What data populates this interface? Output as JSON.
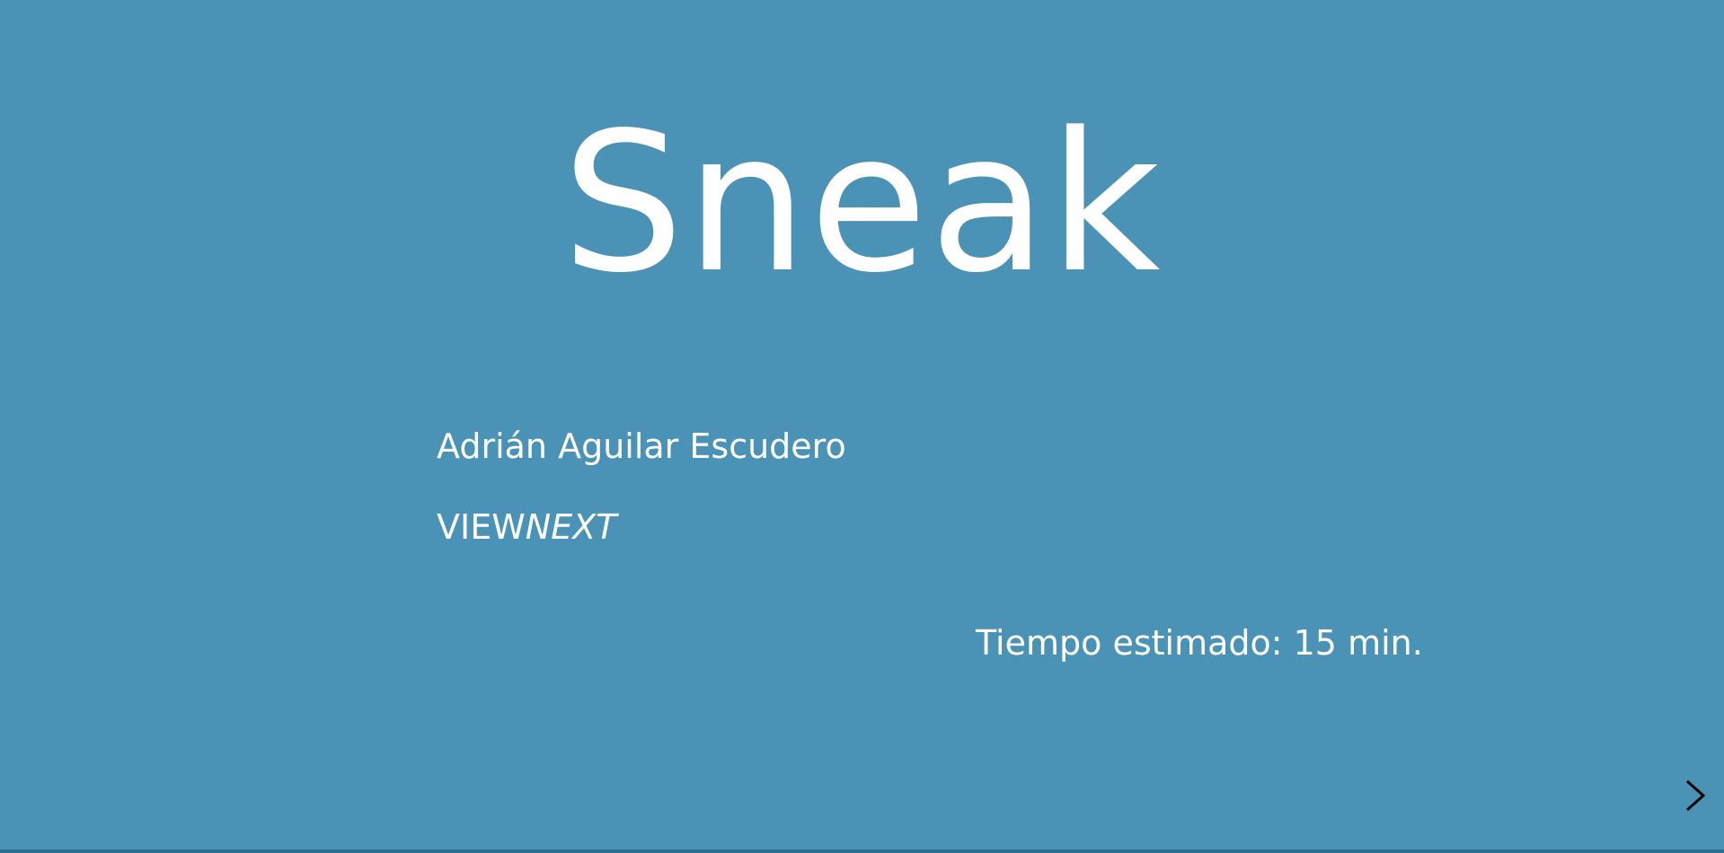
{
  "slide": {
    "title": "Sneak",
    "author": "Adrián Aguilar Escudero",
    "company_prefix": "VIEW",
    "company_suffix": "NEXT",
    "estimated_time": "Tiempo estimado: 15 min."
  },
  "navigation": {
    "next_icon": "chevron-right-icon",
    "progress": 0
  },
  "colors": {
    "background": "#4a93b7",
    "text": "#ffffff",
    "controls": "#000000"
  }
}
